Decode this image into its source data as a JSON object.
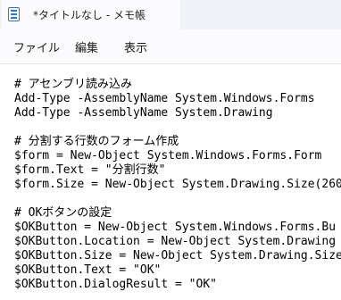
{
  "tab": {
    "title": "*タイトルなし - メモ帳",
    "icon": "notepad-icon"
  },
  "menu": {
    "file": "ファイル",
    "edit": "編集",
    "view": "表示"
  },
  "editor": {
    "lines": [
      "# アセンブリ読み込み",
      "Add-Type -AssemblyName System.Windows.Forms",
      "Add-Type -AssemblyName System.Drawing",
      "",
      "# 分割する行数のフォーム作成",
      "$form = New-Object System.Windows.Forms.Form",
      "$form.Text = \"分割行数\"",
      "$form.Size = New-Object System.Drawing.Size(260",
      "",
      "# OKボタンの設定",
      "$OKButton = New-Object System.Windows.Forms.Bu",
      "$OKButton.Location = New-Object System.Drawing",
      "$OKButton.Size = New-Object System.Drawing.Size",
      "$OKButton.Text = \"OK\"",
      "$OKButton.DialogResult = \"OK\""
    ]
  }
}
